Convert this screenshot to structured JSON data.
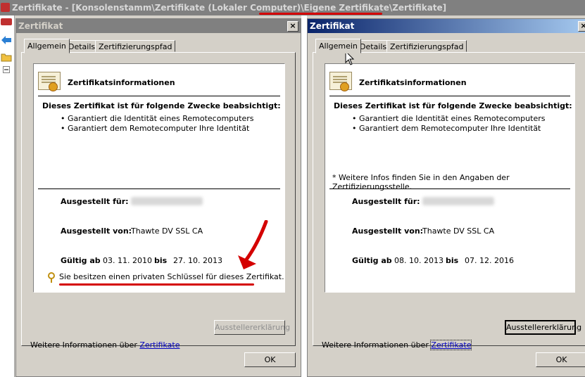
{
  "window": {
    "title": "Zertifikate - [Konsolenstamm\\Zertifikate (Lokaler Computer)\\Eigene Zertifikate\\Zertifikate]"
  },
  "colors": {
    "annotation_red": "#d40000",
    "link": "#0000c0",
    "active_title_start": "#0a246a",
    "active_title_end": "#a6caf0"
  },
  "left_dialog": {
    "title": "Zertifikat",
    "tabs": [
      "Allgemein",
      "Details",
      "Zertifizierungspfad"
    ],
    "header": "Zertifikatsinformationen",
    "purpose_heading": "Dieses Zertifikat ist für folgende Zwecke beabsichtigt:",
    "purposes": [
      "• Garantiert die Identität eines Remotecomputers",
      "• Garantiert dem Remotecomputer Ihre Identität"
    ],
    "issued_to_label": "Ausgestellt für:",
    "issued_by_label": "Ausgestellt von:",
    "issued_by": "Thawte DV SSL CA",
    "valid_from_label": "Gültig ab",
    "valid_from": "03. 11. 2010",
    "valid_to_label": "bis",
    "valid_to": "27. 10. 2013",
    "private_key_note": "Sie besitzen einen privaten Schlüssel für dieses Zertifikat.",
    "issuer_statement_button": "Ausstellererklärung",
    "more_info_text": "Weitere Informationen über",
    "more_info_link": "Zertifikate",
    "ok_button": "OK"
  },
  "right_dialog": {
    "title": "Zertifikat",
    "tabs": [
      "Allgemein",
      "Details",
      "Zertifizierungspfad"
    ],
    "header": "Zertifikatsinformationen",
    "purpose_heading": "Dieses Zertifikat ist für folgende Zwecke beabsichtigt:",
    "purposes": [
      "• Garantiert die Identität eines Remotecomputers",
      "• Garantiert dem Remotecomputer Ihre Identität"
    ],
    "more_info_note": "* Weitere Infos finden Sie in den Angaben der Zertifizierungsstelle.",
    "issued_to_label": "Ausgestellt für:",
    "issued_by_label": "Ausgestellt von:",
    "issued_by": "Thawte DV SSL CA",
    "valid_from_label": "Gültig ab",
    "valid_from": "08. 10. 2013",
    "valid_to_label": "bis",
    "valid_to": "07. 12. 2016",
    "issuer_statement_button": "Ausstellererklärung",
    "more_info_text": "Weitere Informationen über",
    "more_info_link": "Zertifikate",
    "ok_button": "OK"
  }
}
